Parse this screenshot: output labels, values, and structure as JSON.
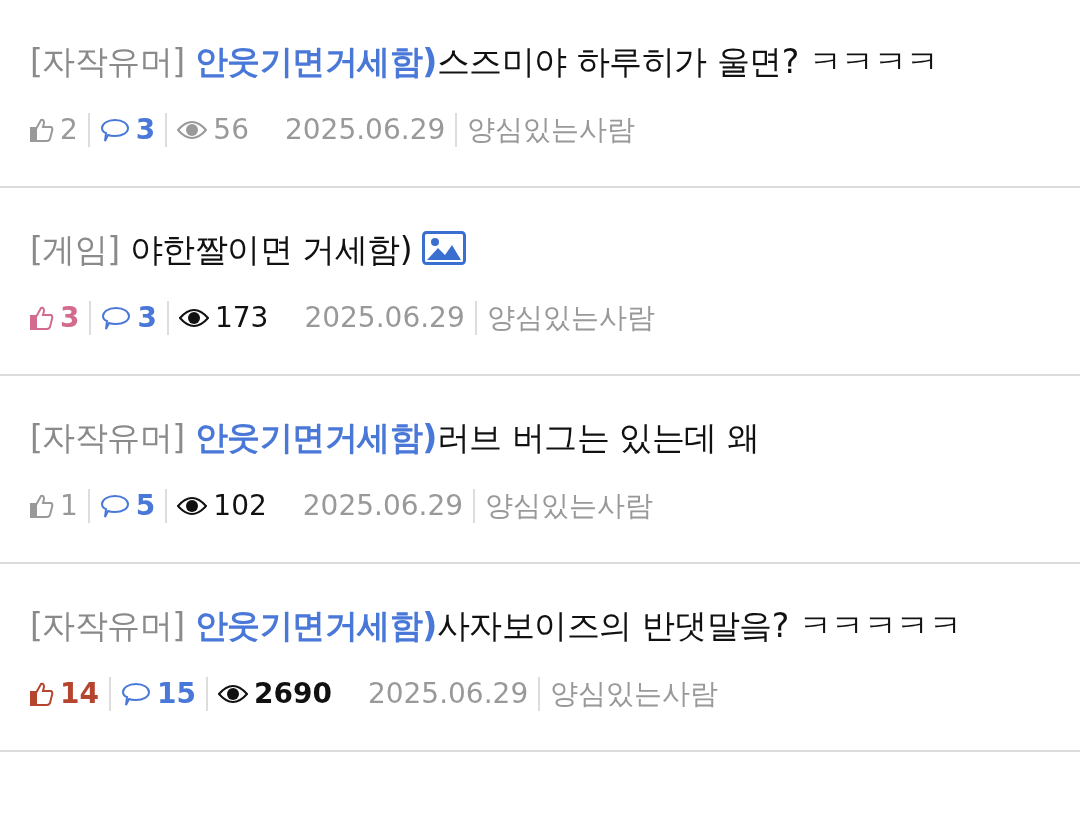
{
  "posts": [
    {
      "category": "[자작유머]",
      "series": "안웃기면거세함)",
      "title": "스즈미야 하루히가 울면? ㅋㅋㅋㅋ",
      "has_image": false,
      "likes": {
        "count": "2",
        "color": "#999999",
        "bold": false
      },
      "comments": "3",
      "views": {
        "count": "56",
        "color": "#999999",
        "bold": false
      },
      "date": "2025.06.29",
      "author": "양심있는사람"
    },
    {
      "category": "[게임]",
      "title": "야한짤이면 거세함)",
      "has_image": true,
      "likes": {
        "count": "3",
        "color": "#d36b8c",
        "bold": true
      },
      "comments": "3",
      "views": {
        "count": "173",
        "color": "#111111",
        "bold": false
      },
      "date": "2025.06.29",
      "author": "양심있는사람"
    },
    {
      "category": "[자작유머]",
      "series": "안웃기면거세함)",
      "title": "러브 버그는 있는데 왜",
      "has_image": false,
      "likes": {
        "count": "1",
        "color": "#999999",
        "bold": false
      },
      "comments": "5",
      "views": {
        "count": "102",
        "color": "#111111",
        "bold": false
      },
      "date": "2025.06.29",
      "author": "양심있는사람"
    },
    {
      "category": "[자작유머]",
      "series": "안웃기면거세함)",
      "title": "사자보이즈의 반댓말읔? ㅋㅋㅋㅋㅋ",
      "has_image": false,
      "likes": {
        "count": "14",
        "color": "#b5452e",
        "bold": true
      },
      "comments": "15",
      "views": {
        "count": "2690",
        "color": "#111111",
        "bold": true
      },
      "date": "2025.06.29",
      "author": "양심있는사람"
    }
  ]
}
